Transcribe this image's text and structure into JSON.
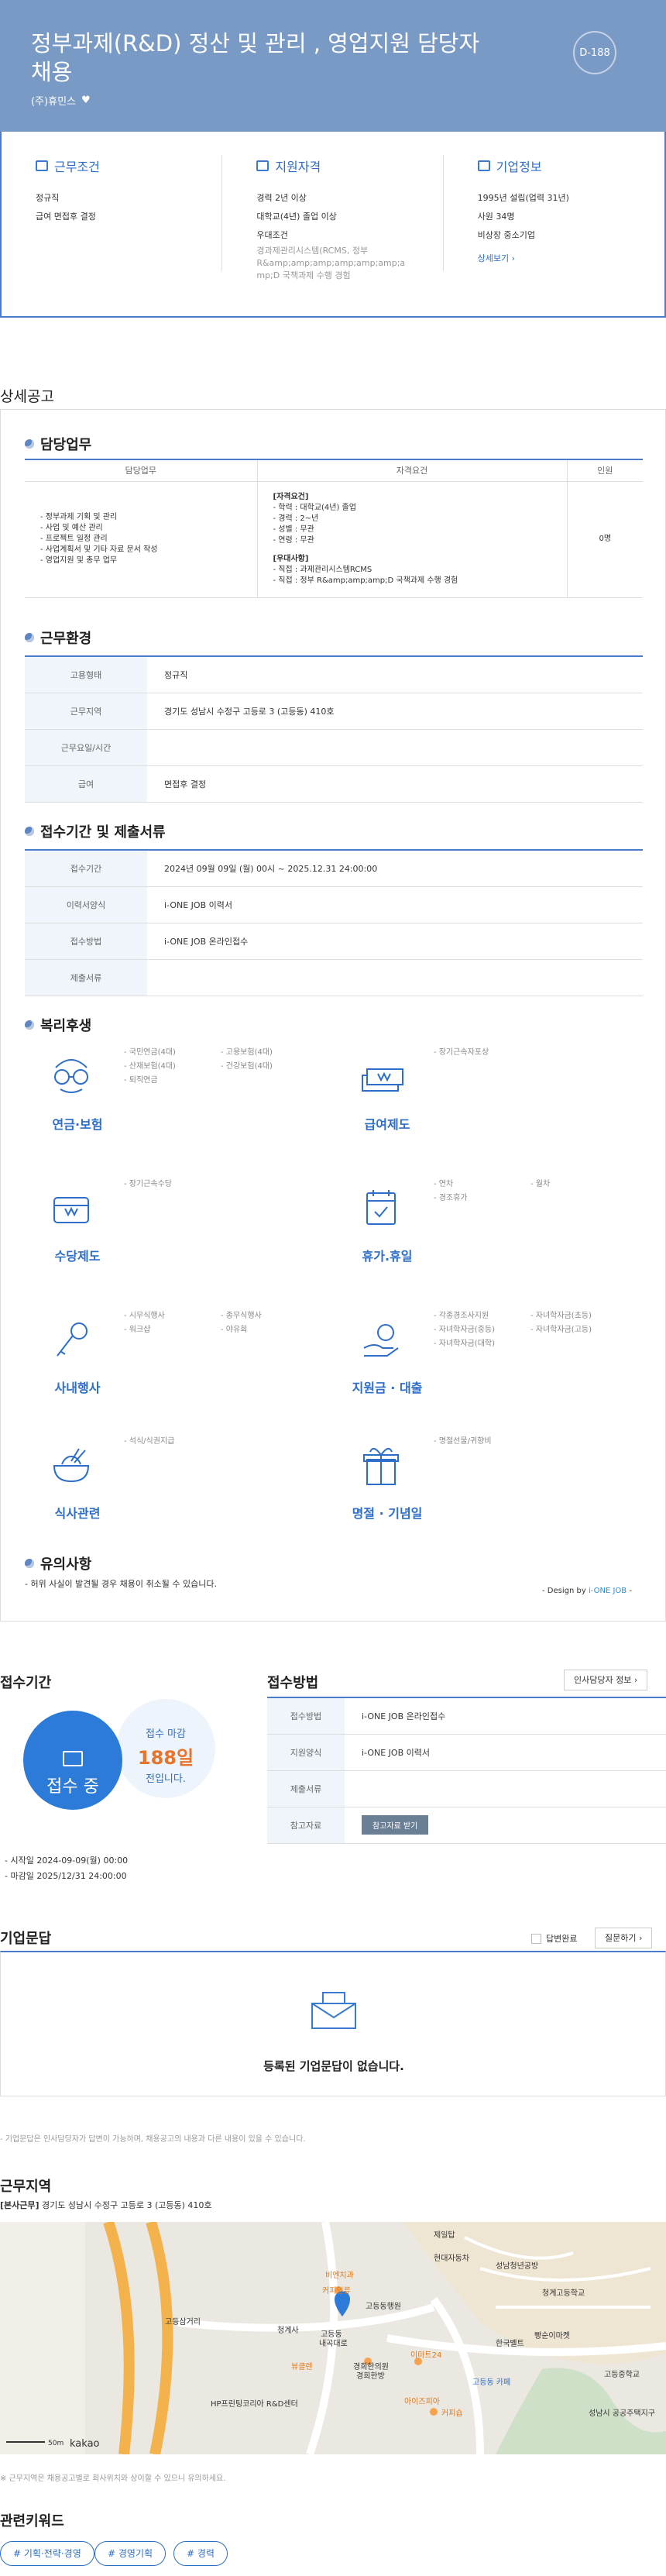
{
  "hero": {
    "title": "정부과제(R&D) 정산 및 관리 , 영업지원 담당자 채용",
    "company": "(주)휴민스",
    "dday": "D-188"
  },
  "summary": [
    {
      "head": "근무조건",
      "lines": [
        "정규직",
        "급여 면접후 결정"
      ]
    },
    {
      "head": "지원자격",
      "lines": [
        "경력 2년 이상",
        "대학교(4년) 졸업 이상",
        "우대조건"
      ],
      "gray": [
        "경과제관리시스템(RCMS, 정부",
        "R&amp;amp;amp;amp;amp;amp;a",
        "mp;D 국책과제 수행 경험"
      ]
    },
    {
      "head": "기업정보",
      "lines": [
        "1995년 설립(업력 31년)",
        "사원 34명",
        "비상장 중소기업"
      ],
      "link": "상세보기 ›"
    }
  ],
  "detail_title": "상세공고",
  "duty": {
    "head": "담당업무",
    "cols": [
      "담당업무",
      "자격요건",
      "인원"
    ],
    "tasks": [
      "- 정부과제 기획 및 관리",
      "- 사업 및 예산 관리",
      "- 프로젝트 일정 관리",
      "- 사업계획서 및 기타 자료 문서 작성",
      "- 영업지원 및 총무 업무"
    ],
    "req_title": "[자격요건]",
    "req": [
      "- 학력 : 대학교(4년) 졸업",
      "- 경력 : 2~년",
      "- 성별 : 무관",
      "- 연령 : 무관"
    ],
    "pref_title": "[우대사항]",
    "pref": [
      "- 직접 : 과제관리시스템RCMS",
      "- 직접 : 정부 R&amp;amp;amp;D 국책과제 수행 경험"
    ],
    "count": "0명"
  },
  "env": {
    "head": "근무환경",
    "rows": [
      [
        "고용형태",
        "정규직"
      ],
      [
        "근무지역",
        "경기도 성남시 수정구 고등로 3 (고등동) 410호"
      ],
      [
        "근무요일/시간",
        ""
      ],
      [
        "급여",
        "면접후 결정"
      ]
    ]
  },
  "apply": {
    "head": "접수기간 및 제출서류",
    "rows": [
      [
        "접수기간",
        "2024년 09월 09일 (월) 00시 ~ 2025.12.31 24:00:00"
      ],
      [
        "이력서양식",
        "i-ONE JOB 이력서"
      ],
      [
        "접수방법",
        "i-ONE JOB 온라인접수"
      ],
      [
        "제출서류",
        ""
      ]
    ]
  },
  "benefit": {
    "head": "복리후생",
    "items": [
      {
        "name": "연금·보험",
        "icon": "glasses-icon",
        "list": [
          "- 국민연금(4대)",
          "- 고용보험(4대)",
          "- 산재보험(4대)",
          "- 건강보험(4대)",
          "- 퇴직연금",
          ""
        ]
      },
      {
        "name": "급여제도",
        "icon": "money-icon",
        "list": [
          "- 장기근속자포상"
        ]
      },
      {
        "name": "수당제도",
        "icon": "wallet-icon",
        "list": [
          "- 장기근속수당"
        ]
      },
      {
        "name": "휴가.휴일",
        "icon": "calendar-icon",
        "list": [
          "- 연차",
          "- 월차",
          "- 경조휴가",
          ""
        ]
      },
      {
        "name": "사내행사",
        "icon": "mic-icon",
        "list": [
          "- 시무식행사",
          "- 종무식행사",
          "- 워크샵",
          "- 야유회"
        ]
      },
      {
        "name": "지원금 · 대출",
        "icon": "hand-coin-icon",
        "list": [
          "- 각종경조사지원",
          "- 자녀학자금(초등)",
          "- 자녀학자금(중등)",
          "- 자녀학자금(고등)",
          "- 자녀학자금(대학)",
          ""
        ]
      },
      {
        "name": "식사관련",
        "icon": "rice-bowl-icon",
        "list": [
          "- 석식/식권지급"
        ]
      },
      {
        "name": "명절 · 기념일",
        "icon": "gift-icon",
        "list": [
          "- 명절선물/귀향비"
        ]
      }
    ]
  },
  "caution": {
    "head": "유의사항",
    "text": "- 허위 사실이 발견될 경우 채용이 취소될 수 있습니다.",
    "design_prefix": "- Design by ",
    "design_brand": "i-ONE JOB",
    "design_suffix": " -"
  },
  "period": {
    "head": "접수기간",
    "status": "접수 중",
    "left_a": "접수 마감",
    "left_b": "188일",
    "left_c": "전입니다.",
    "start": "- 시작일 2024-09-09(월) 00:00",
    "end": "- 마감일 2025/12/31 24:00:00"
  },
  "method": {
    "head": "접수방법",
    "btn": "인사담당자 정보  ›",
    "rows": [
      [
        "접수방법",
        "i-ONE JOB 온라인접수"
      ],
      [
        "지원양식",
        "i-ONE JOB 이력서"
      ],
      [
        "제출서류",
        ""
      ],
      [
        "참고자료",
        ""
      ]
    ],
    "ref_btn": "참고자료 받기"
  },
  "qa": {
    "head": "기업문답",
    "check": "답변완료",
    "btn": "질문하기  ›",
    "empty": "등록된 기업문답이 없습니다.",
    "note": "- 기업문답은 인사담당자가 답변이 가능하며, 채용공고의 내용과 다른 내용이 있을 수 있습니다."
  },
  "location": {
    "head": "근무지역",
    "label": "[본사근무]",
    "addr": "경기도 성남시 수정구 고등로 3 (고등동) 410호",
    "note": "※ 근무지역은 채용공고별로 회사위치와 상이할 수 있으니 유의하세요.",
    "map_labels": [
      "고등삼거리",
      "청계사",
      "고등동",
      "내곡대로",
      "고등동행원",
      "HP프린팅코리아 R&D센터",
      "성남시 공공주택지구",
      "고등중학교",
      "비엔치과",
      "커피인류",
      "뷰클렌",
      "경희한의원",
      "경희한방",
      "이마트24",
      "아이즈피아",
      "커피숍",
      "제일탑",
      "고등동 카페",
      "빵순이마켓",
      "한국벨트",
      "성남청년공방",
      "청계고등학교",
      "현대자동차"
    ],
    "scale": "50m",
    "brand": "kakao"
  },
  "keywords": {
    "head": "관련키워드",
    "items": [
      "# 기획·전략·경영",
      "# 경영기획",
      "# 경력"
    ]
  }
}
